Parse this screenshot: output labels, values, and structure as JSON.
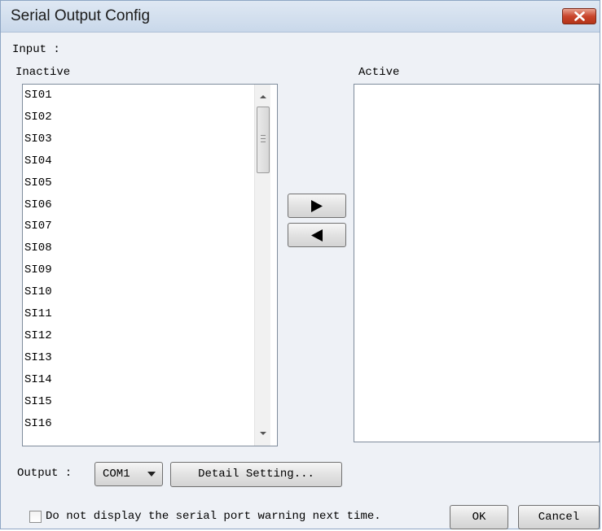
{
  "window": {
    "title": "Serial Output Config"
  },
  "input_section": {
    "label": "Input :"
  },
  "inactive": {
    "label": "Inactive",
    "items": [
      "SI01",
      "SI02",
      "SI03",
      "SI04",
      "SI05",
      "SI06",
      "SI07",
      "SI08",
      "SI09",
      "SI10",
      "SI11",
      "SI12",
      "SI13",
      "SI14",
      "SI15",
      "SI16"
    ]
  },
  "active": {
    "label": "Active",
    "items": []
  },
  "transfer": {
    "add_icon": "right-triangle-icon",
    "remove_icon": "left-triangle-icon"
  },
  "output": {
    "label": "Output :",
    "port_value": "COM1",
    "detail_button": "Detail Setting..."
  },
  "warning_checkbox": {
    "label": "Do not display the serial port warning next time.",
    "checked": false
  },
  "buttons": {
    "ok": "OK",
    "cancel": "Cancel"
  },
  "colors": {
    "titlebar": "#c9d8ea",
    "close_button": "#c9452c",
    "dialog_bg": "#eef1f6"
  }
}
